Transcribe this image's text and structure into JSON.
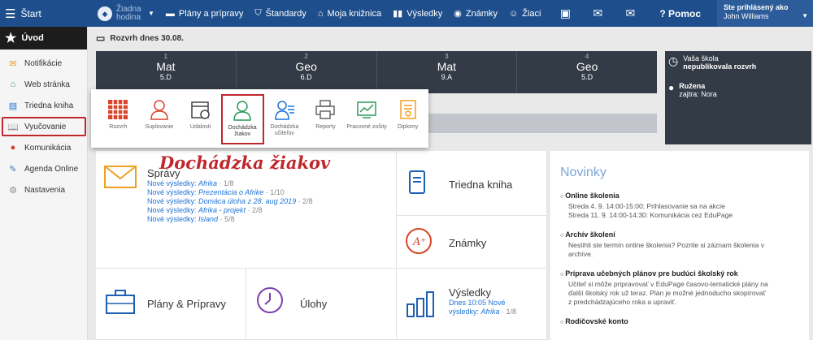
{
  "topbar": {
    "start": "Štart",
    "hodina": "Žiadna hodina",
    "items": [
      "Plány a prípravy",
      "Štandardy",
      "Moja knižnica",
      "Výsledky",
      "Známky",
      "Žiaci"
    ],
    "help": "Pomoc",
    "user_label": "Ste prihlásený ako",
    "user_name": "John Williams"
  },
  "sidebar": {
    "home": "Úvod",
    "items": [
      "Notifikácie",
      "Web stránka",
      "Triedna kniha",
      "Vyučovanie",
      "Komunikácia",
      "Agenda Online",
      "Nastavenia"
    ]
  },
  "schedule": {
    "heading": "Rozvrh dnes 30.08.",
    "lessons": [
      {
        "num": "1",
        "subject": "Mat",
        "cls": "5.D"
      },
      {
        "num": "2",
        "subject": "Geo",
        "cls": "6.D"
      },
      {
        "num": "3",
        "subject": "Mat",
        "cls": "9.A"
      },
      {
        "num": "4",
        "subject": "Geo",
        "cls": "5.D"
      }
    ],
    "side1_a": "Vaša škola",
    "side1_b": "nepublikovala rozvrh",
    "side2_a": "Ružena",
    "side2_b": "zajtra: Nora"
  },
  "popup": {
    "items": [
      "Rozvrh",
      "Suplovanie",
      "Udalosti",
      "Dochádzka žiakov",
      "Dochádzka učiteľov",
      "Reporty",
      "Pracovné zošity",
      "Diplomy"
    ]
  },
  "annotation": "Dochádzka žiakov",
  "tiles": {
    "spravy_title": "Správy",
    "spravy_lines": [
      {
        "prefix": "Nové výsledky: ",
        "name": "Afrika",
        "suffix": " · 1/8"
      },
      {
        "prefix": "Nové výsledky: ",
        "name": "Prezentácia o Afrike",
        "suffix": " · 1/10"
      },
      {
        "prefix": "Nové výsledky: ",
        "name": "Domáca úloha z 28. aug 2019",
        "suffix": " · 2/8"
      },
      {
        "prefix": "Nové výsledky: ",
        "name": "Afrika - projekt",
        "suffix": " · 2/8"
      },
      {
        "prefix": "Nové výsledky: ",
        "name": "Island",
        "suffix": " · 5/8"
      }
    ],
    "triedna": "Triedna kniha",
    "znamky": "Známky",
    "plany": "Plány & Prípravy",
    "ulohy": "Úlohy",
    "vysledky": "Výsledky",
    "vysledky_sub1": "Dnes 10:05 Nové",
    "vysledky_sub2": "výsledky: ",
    "vysledky_name": "Afrika",
    "vysledky_suffix": " · 1/8"
  },
  "news": {
    "title": "Novinky",
    "items": [
      {
        "title": "Online školenia",
        "body": [
          "Streda 4. 9. 14:00-15:00: Prihlasovanie sa na akcie",
          "Streda 11. 9. 14:00-14:30: Komunikácia cez EduPage"
        ]
      },
      {
        "title": "Archív školení",
        "body": [
          "Nestihli ste termín online školenia? Pozrite si záznam školenia v",
          "archíve."
        ]
      },
      {
        "title": "Príprava učebných plánov pre budúci školský rok",
        "body": [
          "Učiteľ si môže pripravovať v EduPage časovo-tematické plány na",
          "ďalší školský rok už teraz. Plán je možné jednoducho skopírovať",
          "z predchádzajúceho roka a upraviť."
        ]
      },
      {
        "title": "Rodičovské konto",
        "body": []
      }
    ]
  },
  "colors": {
    "topbar": "#1e4f8c",
    "accent_red": "#c0272d",
    "link": "#1e73d8",
    "schedule_bg": "#333b46"
  }
}
